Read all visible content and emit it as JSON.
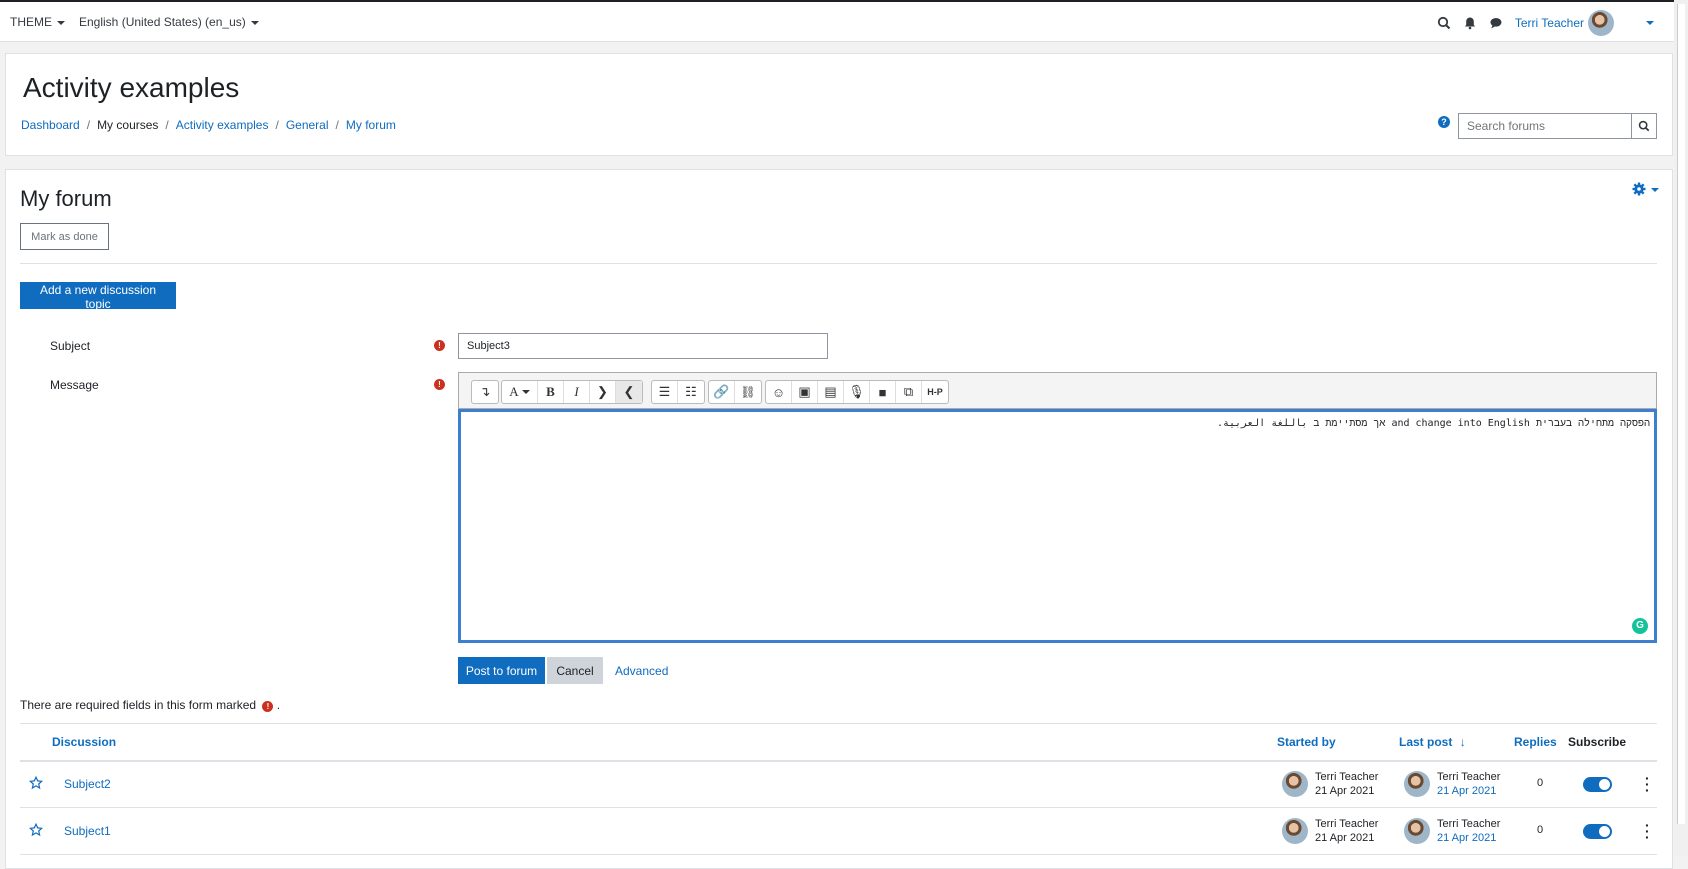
{
  "navbar": {
    "theme_label": "THEME",
    "language_label": "English (United States) (en_us)",
    "user_name": "Terri Teacher"
  },
  "header": {
    "title": "Activity examples",
    "breadcrumb": [
      "Dashboard",
      "My courses",
      "Activity examples",
      "General",
      "My forum"
    ],
    "search_placeholder": "Search forums"
  },
  "main": {
    "title": "My forum",
    "mark_done_label": "Mark as done",
    "add_topic_label": "Add a new discussion topic",
    "form": {
      "subject_label": "Subject",
      "subject_value": "Subject3",
      "message_label": "Message",
      "message_text": "הפסקה מתחילה בעברית and change into English אך מסתיימת ב باللغة العربية."
    },
    "buttons": {
      "post_label": "Post to forum",
      "cancel_label": "Cancel",
      "advanced_label": "Advanced"
    },
    "required_note": "There are required fields in this form marked",
    "required_note_suffix": "."
  },
  "table": {
    "columns": {
      "discussion": "Discussion",
      "started_by": "Started by",
      "last_post": "Last post",
      "replies": "Replies",
      "subscribe": "Subscribe"
    },
    "rows": [
      {
        "subject": "Subject2",
        "started_name": "Terri Teacher",
        "started_date": "21 Apr 2021",
        "last_name": "Terri Teacher",
        "last_date": "21 Apr 2021",
        "replies": "0"
      },
      {
        "subject": "Subject1",
        "started_name": "Terri Teacher",
        "started_date": "21 Apr 2021",
        "last_name": "Terri Teacher",
        "last_date": "21 Apr 2021",
        "replies": "0"
      }
    ]
  },
  "colors": {
    "primary": "#0f6cbf",
    "danger": "#ca3120",
    "grammarly": "#15c39a"
  }
}
